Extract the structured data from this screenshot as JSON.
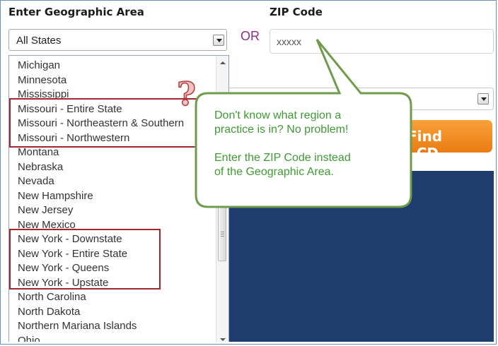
{
  "labels": {
    "geo_area": "Enter Geographic Area",
    "zip": "ZIP Code",
    "or": "OR"
  },
  "state_select": {
    "value": "All States"
  },
  "zip_input": {
    "value": "xxxxx"
  },
  "find_button": {
    "label": "Find LCD"
  },
  "state_list": [
    "Michigan",
    "Minnesota",
    "Mississippi",
    "Missouri - Entire State",
    "Missouri - Northeastern & Southern",
    "Missouri - Northwestern",
    "Montana",
    "Nebraska",
    "Nevada",
    "New Hampshire",
    "New Jersey",
    "New Mexico",
    "New York - Downstate",
    "New York - Entire State",
    "New York - Queens",
    "New York - Upstate",
    "North Carolina",
    "North Dakota",
    "Northern Mariana Islands",
    "Ohio"
  ],
  "callout": {
    "line1": "Don't know what region a",
    "line2": "practice is in? No problem!",
    "line3": "Enter the ZIP Code instead",
    "line4": "of the Geographic Area."
  },
  "annotation": {
    "question_mark": "?"
  },
  "colors": {
    "accent_red": "#a1282e",
    "callout_green": "#3e9a33",
    "button_orange": "#ea7c11",
    "panel_blue": "#1f3c6e",
    "or_purple": "#8b2f88"
  },
  "icons": [
    "dropdown-arrow-icon",
    "scroll-up-icon",
    "scroll-down-icon",
    "question-mark-icon"
  ]
}
